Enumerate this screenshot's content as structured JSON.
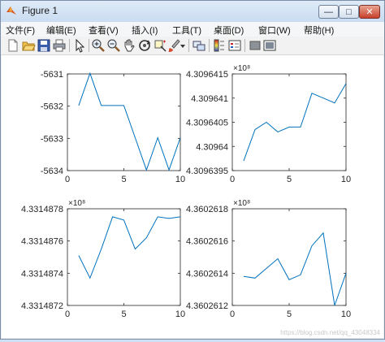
{
  "window": {
    "title": "Figure 1",
    "buttons": {
      "minimize": "—",
      "maximize": "□",
      "close": "✕"
    }
  },
  "menu": [
    "文件(F)",
    "编辑(E)",
    "查看(V)",
    "插入(I)",
    "工具(T)",
    "桌面(D)",
    "窗口(W)",
    "帮助(H)"
  ],
  "toolbar": {
    "icons": [
      "new-figure-icon",
      "open-file-icon",
      "save-icon",
      "print-icon",
      "select-arrow-icon",
      "zoom-in-icon",
      "zoom-out-icon",
      "pan-hand-icon",
      "rotate-3d-icon",
      "data-cursor-icon",
      "brush-icon",
      "brush-dropdown-icon",
      "link-plot-icon",
      "colorbar-icon",
      "legend-icon",
      "hide-plot-tools-icon",
      "show-plot-tools-icon"
    ]
  },
  "watermark": "https://blog.csdn.net/qq_43048334",
  "chart_data": [
    {
      "type": "line",
      "x": [
        1,
        2,
        3,
        4,
        5,
        6,
        7,
        8,
        9,
        10
      ],
      "y": [
        -5631.98,
        -5630.98,
        -5631.98,
        -5631.98,
        -5631.98,
        -5632.98,
        -5633.98,
        -5632.98,
        -5633.98,
        -5632.98
      ],
      "xlim": [
        0,
        10
      ],
      "ylim": [
        -5634,
        -5631
      ],
      "xticks": [
        "0",
        "5",
        "10"
      ],
      "yticks": [
        "-5631",
        "-5632",
        "-5633",
        "-5634"
      ],
      "exponent_label": "",
      "color": "#0072bd"
    },
    {
      "type": "line",
      "x": [
        1,
        2,
        3,
        4,
        5,
        6,
        7,
        8,
        9,
        10
      ],
      "y": [
        4.3096397,
        4.30964035,
        4.3096405,
        4.3096403,
        4.3096404,
        4.3096404,
        4.3096411,
        4.309641,
        4.3096409,
        4.3096413
      ],
      "xlim": [
        0,
        10
      ],
      "ylim": [
        4.3096395,
        4.3096415
      ],
      "xticks": [
        "0",
        "5",
        "10"
      ],
      "yticks": [
        "4.3096415",
        "4.309641",
        "4.3096405",
        "4.30964",
        "4.3096395"
      ],
      "exponent_label": "×10⁸",
      "color": "#0072bd"
    },
    {
      "type": "line",
      "x": [
        1,
        2,
        3,
        4,
        5,
        6,
        7,
        8,
        9,
        10
      ],
      "y": [
        4.33148751,
        4.33148737,
        4.33148755,
        4.33148775,
        4.33148773,
        4.33148755,
        4.33148762,
        4.33148775,
        4.33148774,
        4.33148775
      ],
      "xlim": [
        0,
        10
      ],
      "ylim": [
        4.3314872,
        4.3314878
      ],
      "xticks": [
        "0",
        "5",
        "10"
      ],
      "yticks": [
        "4.3314878",
        "4.3314876",
        "4.3314874",
        "4.3314872"
      ],
      "exponent_label": "×10⁸",
      "color": "#0072bd"
    },
    {
      "type": "line",
      "x": [
        1,
        2,
        3,
        4,
        5,
        6,
        7,
        8,
        9,
        10
      ],
      "y": [
        4.36026138,
        4.36026137,
        4.36026143,
        4.36026149,
        4.36026136,
        4.36026139,
        4.36026157,
        4.36026165,
        4.3602612,
        4.3602614
      ],
      "xlim": [
        0,
        10
      ],
      "ylim": [
        4.3602612,
        4.3602618
      ],
      "xticks": [
        "0",
        "5",
        "10"
      ],
      "yticks": [
        "4.3602618",
        "4.3602616",
        "4.3602614",
        "4.3602612"
      ],
      "exponent_label": "×10⁸",
      "color": "#0072bd"
    }
  ]
}
